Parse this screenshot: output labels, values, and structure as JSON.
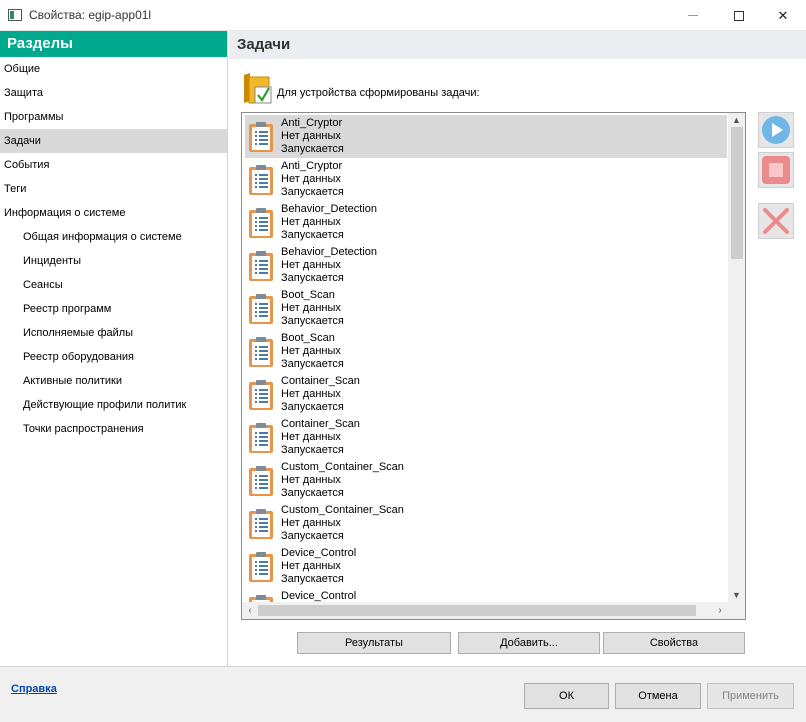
{
  "window": {
    "title": "Свойства: egip-app01l",
    "minimize_glyph": "",
    "close_glyph": "✕"
  },
  "nav": {
    "header": "Разделы",
    "items": [
      {
        "label": "Общие",
        "sub": false,
        "active": false
      },
      {
        "label": "Защита",
        "sub": false,
        "active": false
      },
      {
        "label": "Программы",
        "sub": false,
        "active": false
      },
      {
        "label": "Задачи",
        "sub": false,
        "active": true
      },
      {
        "label": "События",
        "sub": false,
        "active": false
      },
      {
        "label": "Теги",
        "sub": false,
        "active": false
      },
      {
        "label": "Информация о системе",
        "sub": false,
        "active": false
      },
      {
        "label": "Общая информация о системе",
        "sub": true,
        "active": false
      },
      {
        "label": "Инциденты",
        "sub": true,
        "active": false
      },
      {
        "label": "Сеансы",
        "sub": true,
        "active": false
      },
      {
        "label": "Реестр программ",
        "sub": true,
        "active": false
      },
      {
        "label": "Исполняемые файлы",
        "sub": true,
        "active": false
      },
      {
        "label": "Реестр оборудования",
        "sub": true,
        "active": false
      },
      {
        "label": "Активные политики",
        "sub": true,
        "active": false
      },
      {
        "label": "Действующие профили политик",
        "sub": true,
        "active": false
      },
      {
        "label": "Точки распространения",
        "sub": true,
        "active": false
      }
    ]
  },
  "main": {
    "title": "Задачи",
    "caption": "Для устройства сформированы задачи:",
    "tasks": [
      {
        "name": "Anti_Cryptor",
        "status": "Нет данных",
        "state": "Запускается",
        "selected": true
      },
      {
        "name": "Anti_Cryptor",
        "status": "Нет данных",
        "state": "Запускается",
        "selected": false
      },
      {
        "name": "Behavior_Detection",
        "status": "Нет данных",
        "state": "Запускается",
        "selected": false
      },
      {
        "name": "Behavior_Detection",
        "status": "Нет данных",
        "state": "Запускается",
        "selected": false
      },
      {
        "name": "Boot_Scan",
        "status": "Нет данных",
        "state": "Запускается",
        "selected": false
      },
      {
        "name": "Boot_Scan",
        "status": "Нет данных",
        "state": "Запускается",
        "selected": false
      },
      {
        "name": "Container_Scan",
        "status": "Нет данных",
        "state": "Запускается",
        "selected": false
      },
      {
        "name": "Container_Scan",
        "status": "Нет данных",
        "state": "Запускается",
        "selected": false
      },
      {
        "name": "Custom_Container_Scan",
        "status": "Нет данных",
        "state": "Запускается",
        "selected": false
      },
      {
        "name": "Custom_Container_Scan",
        "status": "Нет данных",
        "state": "Запускается",
        "selected": false
      },
      {
        "name": "Device_Control",
        "status": "Нет данных",
        "state": "Запускается",
        "selected": false
      },
      {
        "name": "Device_Control",
        "status": "",
        "state": "",
        "selected": false
      }
    ],
    "buttons": {
      "results": "Результаты",
      "add": "Добавить...",
      "properties": "Свойства"
    },
    "side_buttons": [
      {
        "icon": "play-icon",
        "color": "#1e90e0"
      },
      {
        "icon": "stop-icon",
        "color": "#e05a5a"
      },
      {
        "icon": "delete-icon",
        "color": "#e05a5a"
      }
    ]
  },
  "footer": {
    "help": "Справка",
    "ok": "ОК",
    "cancel": "Отмена",
    "apply": "Применить"
  },
  "colors": {
    "accent": "#00a88e",
    "selection": "#d9d9d9",
    "link": "#0645ad"
  }
}
